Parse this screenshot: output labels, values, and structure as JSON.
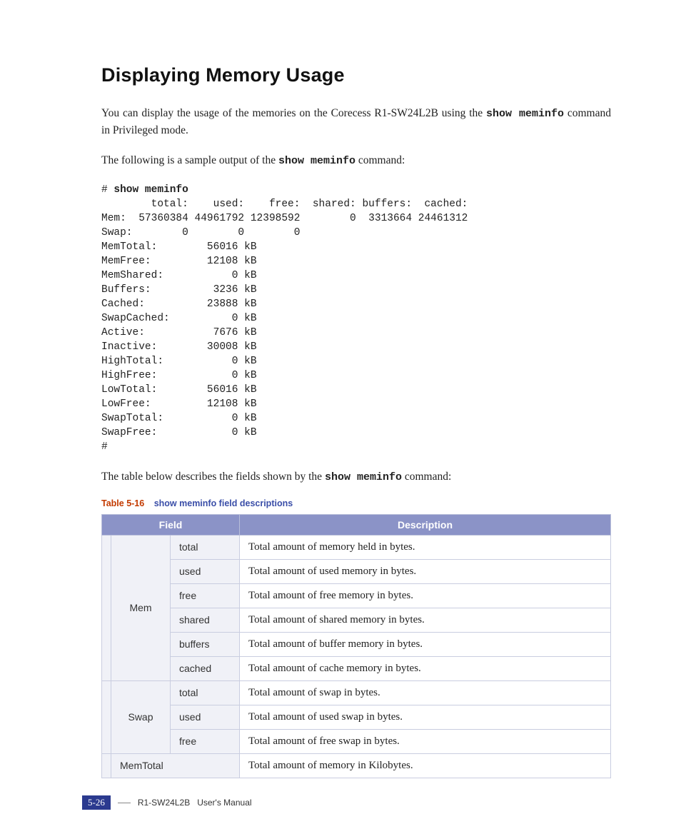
{
  "heading": "Displaying Memory Usage",
  "intro_before_cmd": "You can display the usage of the memories on the Corecess R1-SW24L2B using the ",
  "intro_cmd": "show meminfo",
  "intro_after_cmd": " command in Privileged mode.",
  "sample_before_cmd": "The following is a sample output of the ",
  "sample_cmd": "show meminfo",
  "sample_after_cmd": " command:",
  "terminal": {
    "prompt_line_prefix": "# ",
    "prompt_cmd": "show meminfo",
    "header": "        total:    used:    free:  shared: buffers:  cached:",
    "mem": "Mem:  57360384 44961792 12398592        0  3313664 24461312",
    "swap": "Swap:        0        0        0",
    "rows": [
      "MemTotal:        56016 kB",
      "MemFree:         12108 kB",
      "MemShared:           0 kB",
      "Buffers:          3236 kB",
      "Cached:          23888 kB",
      "SwapCached:          0 kB",
      "Active:           7676 kB",
      "Inactive:        30008 kB",
      "HighTotal:           0 kB",
      "HighFree:            0 kB",
      "LowTotal:        56016 kB",
      "LowFree:         12108 kB",
      "SwapTotal:           0 kB",
      "SwapFree:            0 kB"
    ],
    "end_prompt": "#"
  },
  "table_intro_before_cmd": "The table below describes the fields shown by the ",
  "table_intro_cmd": "show meminfo",
  "table_intro_after_cmd": " command:",
  "table_caption_num": "Table 5-16",
  "table_caption_title": "show meminfo field descriptions",
  "table": {
    "head_field": "Field",
    "head_desc": "Description",
    "groups": [
      {
        "name": "Mem",
        "rows": [
          {
            "sub": "total",
            "desc": "Total amount of memory held in bytes."
          },
          {
            "sub": "used",
            "desc": "Total amount of used memory in bytes."
          },
          {
            "sub": "free",
            "desc": "Total amount of free memory in bytes."
          },
          {
            "sub": "shared",
            "desc": "Total amount of shared memory in bytes."
          },
          {
            "sub": "buffers",
            "desc": "Total amount of buffer memory in bytes."
          },
          {
            "sub": "cached",
            "desc": "Total amount of cache memory in bytes."
          }
        ]
      },
      {
        "name": "Swap",
        "rows": [
          {
            "sub": "total",
            "desc": "Total amount of swap in bytes."
          },
          {
            "sub": "used",
            "desc": "Total amount of used swap in bytes."
          },
          {
            "sub": "free",
            "desc": "Total amount of free swap in bytes."
          }
        ]
      }
    ],
    "flat_rows": [
      {
        "field": "MemTotal",
        "desc": "Total amount of memory in Kilobytes."
      }
    ]
  },
  "footer": {
    "page": "5-26",
    "product": "R1-SW24L2B",
    "label": "User's Manual"
  }
}
